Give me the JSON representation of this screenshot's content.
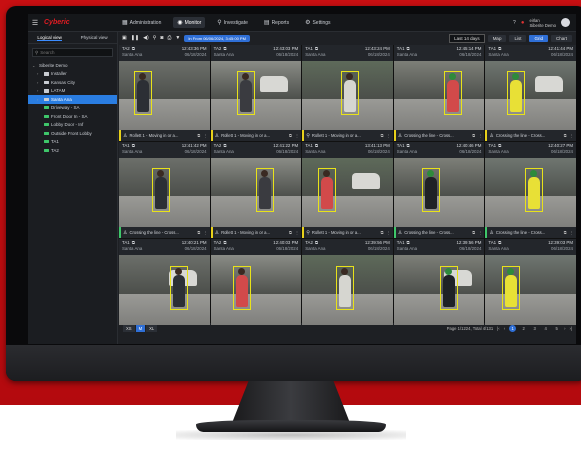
{
  "topbar": {
    "logo": "Cyberic",
    "nav": [
      {
        "label": "Administration",
        "icon": "apps-icon",
        "active": false
      },
      {
        "label": "Monitor",
        "icon": "monitor-icon",
        "active": true
      },
      {
        "label": "Investigate",
        "icon": "search-icon",
        "active": false
      },
      {
        "label": "Reports",
        "icon": "report-icon",
        "active": false
      },
      {
        "label": "Settings",
        "icon": "gear-icon",
        "active": false
      }
    ],
    "user_line1": "eirlan",
    "user_line2": "Siberite Demo"
  },
  "left_panel": {
    "tabs": [
      "Logical view",
      "Physical view"
    ],
    "search_placeholder": "Search",
    "tree": [
      {
        "label": "Siberite Demo",
        "level": 0,
        "kind": "root"
      },
      {
        "label": "Installer",
        "level": 1,
        "kind": "folder"
      },
      {
        "label": "Kansas City",
        "level": 1,
        "kind": "folder"
      },
      {
        "label": "LATAM",
        "level": 1,
        "kind": "folder"
      },
      {
        "label": "Santa Ana",
        "level": 1,
        "kind": "folder",
        "selected": true
      },
      {
        "label": "Driveway - SA",
        "level": 2,
        "kind": "camera"
      },
      {
        "label": "Front Door In - SA",
        "level": 2,
        "kind": "camera"
      },
      {
        "label": "Lobby Door - Inf",
        "level": 2,
        "kind": "camera"
      },
      {
        "label": "Outside Front Lobby",
        "level": 2,
        "kind": "camera"
      },
      {
        "label": "TA1",
        "level": 2,
        "kind": "camera"
      },
      {
        "label": "TA2",
        "level": 2,
        "kind": "camera"
      }
    ]
  },
  "toolbar": {
    "time_pill": "In From 06/06/2024, 3:45:00 PM",
    "range": "Last 14 days",
    "views": [
      {
        "label": "Map",
        "active": false
      },
      {
        "label": "List",
        "active": false
      },
      {
        "label": "Grid",
        "active": true
      },
      {
        "label": "Chart",
        "active": false
      }
    ]
  },
  "cards": [
    {
      "cam": "TA2",
      "time": "12:43:36 PM",
      "site": "Santa Ana",
      "date": "06/18/2024",
      "rule": "Rollett 1 - Moving in or a...",
      "tag": "yellow",
      "scene": "street"
    },
    {
      "cam": "TA2",
      "time": "12:43:03 PM",
      "site": "Santa Ana",
      "date": "06/18/2024",
      "rule": "Rollett 1 - Moving in or a...",
      "tag": "yellow",
      "scene": "street"
    },
    {
      "cam": "TA1",
      "time": "12:43:24 PM",
      "site": "Santa Ana",
      "date": "06/18/2024",
      "rule": "Rollett 1 - Moving in or a...",
      "tag": "yellow",
      "scene": "bike"
    },
    {
      "cam": "TA1",
      "time": "12:45:14 PM",
      "site": "Santa Ana",
      "date": "06/18/2024",
      "rule": "Crossing the line - Cross...",
      "tag": "yellow",
      "scene": "street"
    },
    {
      "cam": "TA1",
      "time": "12:41:44 PM",
      "site": "Santa Ana",
      "date": "06/18/2024",
      "rule": "Crossing the line - Cross...",
      "tag": "yellow",
      "scene": "street"
    },
    {
      "cam": "TA1",
      "time": "12:41:42 PM",
      "site": "Santa Ana",
      "date": "06/18/2024",
      "rule": "Crossing the line - Cross...",
      "tag": "green",
      "scene": "street"
    },
    {
      "cam": "TA2",
      "time": "12:41:22 PM",
      "site": "Santa Ana",
      "date": "06/18/2024",
      "rule": "Rollett 1 - Moving in or a...",
      "tag": "yellow",
      "scene": "street"
    },
    {
      "cam": "TA1",
      "time": "13:41:13 PM",
      "site": "Santa Ana",
      "date": "06/18/2024",
      "rule": "Rollett 1 - Moving in or a...",
      "tag": "yellow",
      "scene": "bike"
    },
    {
      "cam": "TA1",
      "time": "12:40:46 PM",
      "site": "Santa Ana",
      "date": "06/18/2024",
      "rule": "Crossing the line - Cross...",
      "tag": "green",
      "scene": "street"
    },
    {
      "cam": "TA1",
      "time": "12:40:27 PM",
      "site": "Santa Ana",
      "date": "06/18/2024",
      "rule": "Crossing the line - Cross...",
      "tag": "green",
      "scene": "street"
    },
    {
      "cam": "TA1",
      "time": "12:40:21 PM",
      "site": "Santa Ana",
      "date": "06/18/2024",
      "rule": "",
      "tag": "green",
      "scene": "street"
    },
    {
      "cam": "TA2",
      "time": "12:40:03 PM",
      "site": "Santa Ana",
      "date": "06/18/2024",
      "rule": "",
      "tag": "yellow",
      "scene": "street"
    },
    {
      "cam": "TA2",
      "time": "12:39:56 PM",
      "site": "Santa Ana",
      "date": "06/18/2024",
      "rule": "",
      "tag": "yellow",
      "scene": "bike"
    },
    {
      "cam": "TA1",
      "time": "12:39:56 PM",
      "site": "Santa Ana",
      "date": "06/18/2024",
      "rule": "",
      "tag": "green",
      "scene": "street"
    },
    {
      "cam": "TA1",
      "time": "12:39:03 PM",
      "site": "Santa Ana",
      "date": "06/18/2024",
      "rule": "",
      "tag": "green",
      "scene": "street"
    }
  ],
  "bottom": {
    "zoom": [
      {
        "label": "XS",
        "active": false
      },
      {
        "label": "M",
        "active": true
      },
      {
        "label": "XL",
        "active": false
      }
    ],
    "page_info": "Page 1/1224, Total 4/131",
    "pages": [
      "1",
      "2",
      "3",
      "4",
      "5"
    ],
    "current_page": 1
  }
}
